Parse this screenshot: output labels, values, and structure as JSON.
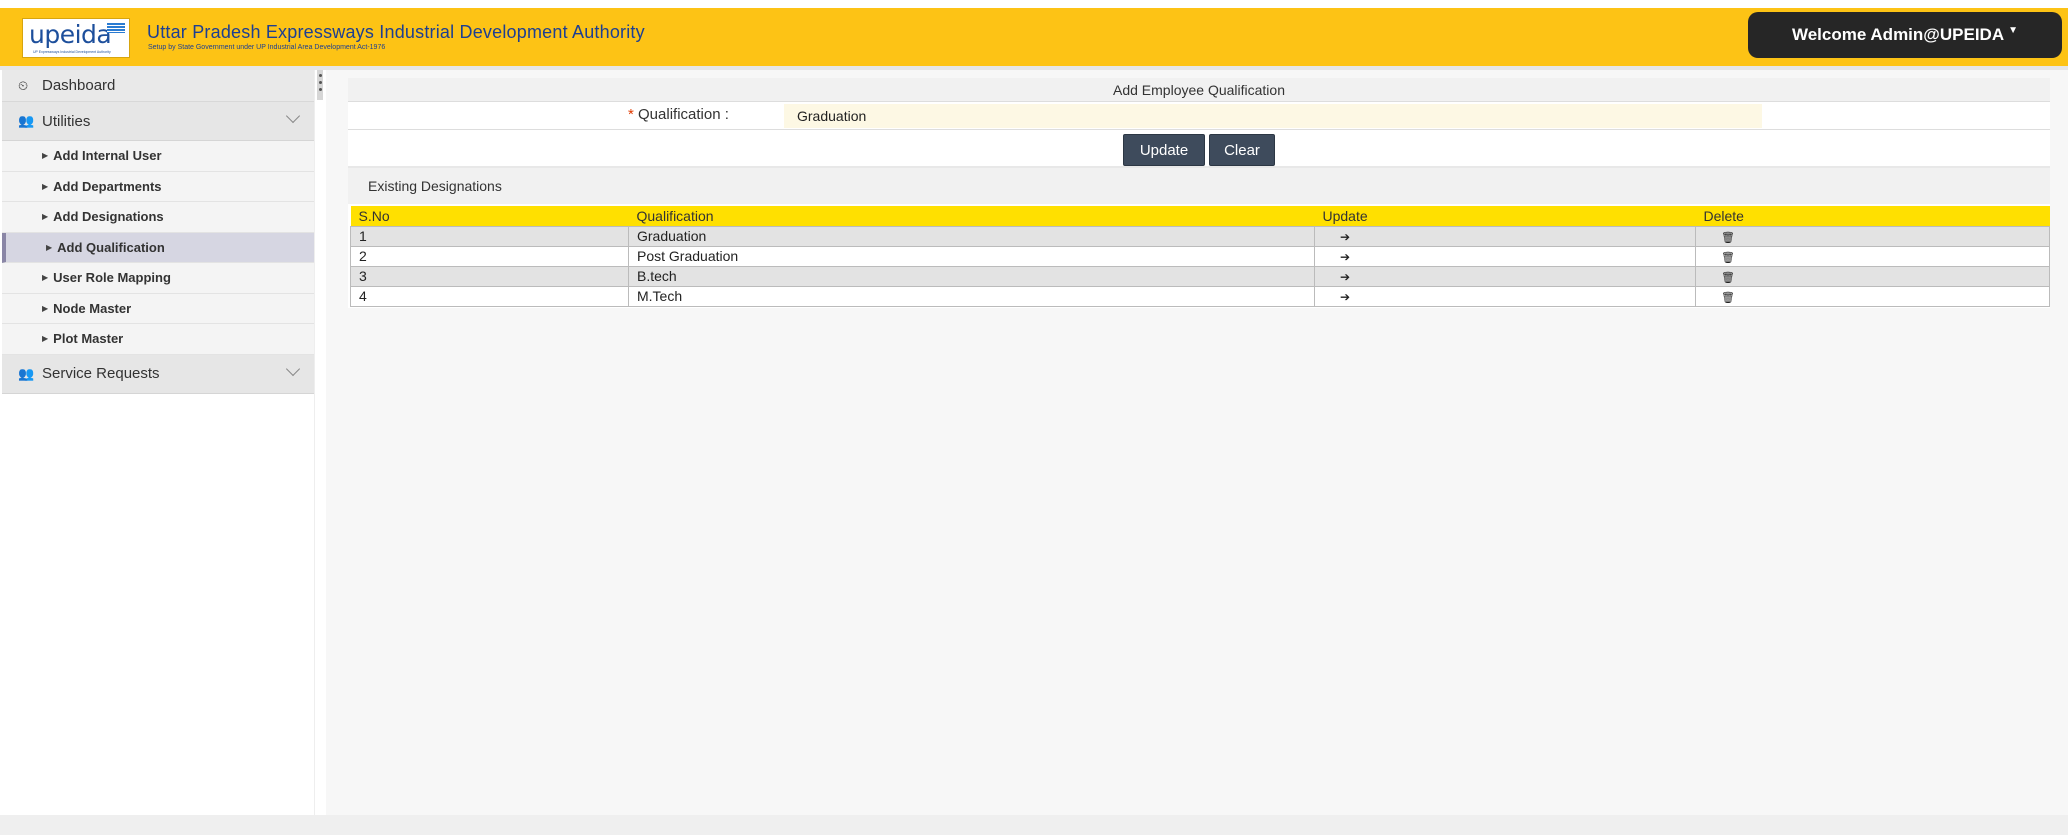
{
  "header": {
    "logo_word": "upeida",
    "logo_tag": "UP Expressways Industrial Development Authority",
    "title": "Uttar Pradesh Expressways Industrial Development Authority",
    "subtitle": "Setup by State Government under UP Industrial Area Development Act-1976",
    "welcome": "Welcome Admin@UPEIDA",
    "brand_color": "#fdc315"
  },
  "sidebar": {
    "dashboard": "Dashboard",
    "utilities": "Utilities",
    "items": [
      {
        "label": "Add Internal User"
      },
      {
        "label": "Add Departments"
      },
      {
        "label": "Add Designations"
      },
      {
        "label": "Add Qualification"
      },
      {
        "label": "User Role Mapping"
      },
      {
        "label": "Node Master"
      },
      {
        "label": "Plot Master"
      }
    ],
    "service_requests": "Service Requests"
  },
  "form": {
    "title": "Add Employee Qualification",
    "qualification_label": "Qualification :",
    "required_mark": "*",
    "qualification_value": "Graduation",
    "update_label": "Update",
    "clear_label": "Clear"
  },
  "list": {
    "title": "Existing Designations",
    "columns": [
      "S.No",
      "Qualification",
      "Update",
      "Delete"
    ],
    "rows": [
      {
        "sno": "1",
        "qualification": "Graduation"
      },
      {
        "sno": "2",
        "qualification": "Post Graduation"
      },
      {
        "sno": "3",
        "qualification": "B.tech"
      },
      {
        "sno": "4",
        "qualification": "M.Tech"
      }
    ],
    "header_color": "#ffe000"
  }
}
